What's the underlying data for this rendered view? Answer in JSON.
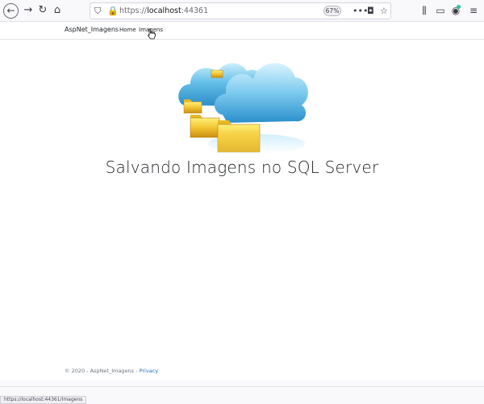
{
  "browser": {
    "url_scheme": "https://",
    "url_host": "localhost",
    "url_port": ":44361",
    "zoom": "67%",
    "status_url": "https://localhost:44361/Imagens"
  },
  "navbar": {
    "brand": "AspNet_Imagens",
    "links": [
      {
        "label": "Home"
      },
      {
        "label": "Imagens"
      }
    ]
  },
  "main": {
    "heading": "Salvando Imagens no SQL Server"
  },
  "footer": {
    "copyright": "© 2020 - AspNet_Imagens -",
    "privacy_label": "Privacy"
  },
  "colors": {
    "link": "#1b6ec2",
    "cloud": "#3aa6d8",
    "folder": "#f2c531"
  }
}
